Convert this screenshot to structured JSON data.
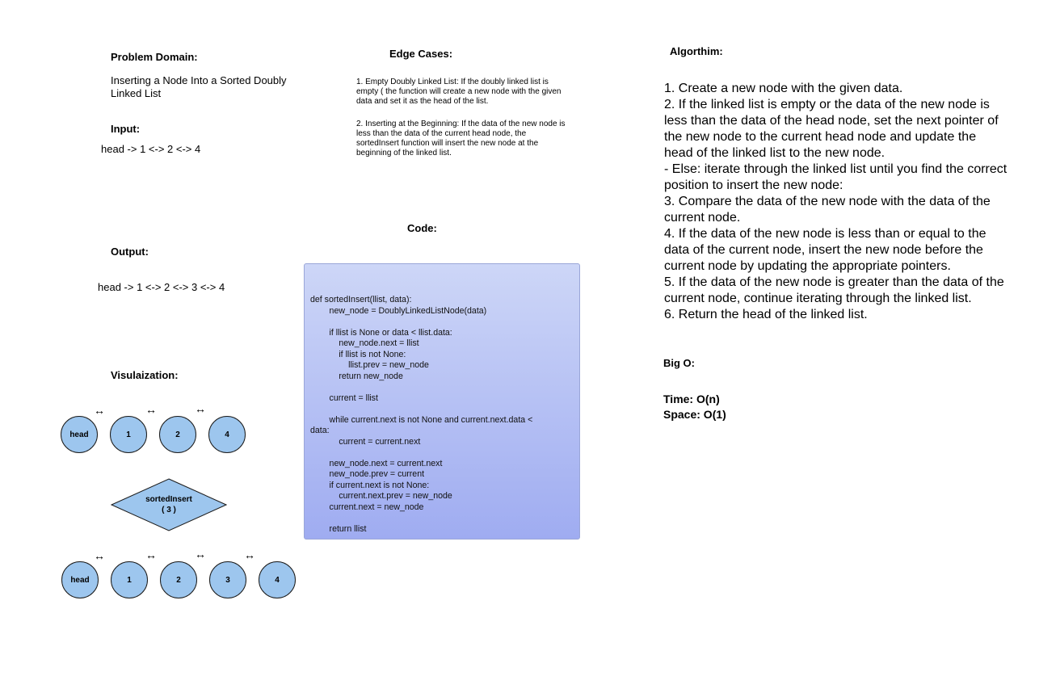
{
  "problem_domain": {
    "heading": "Problem Domain:",
    "text": "Inserting a Node Into a Sorted Doubly\nLinked List"
  },
  "input": {
    "heading": "Input:",
    "text": "head -> 1 <-> 2 <-> 4"
  },
  "output": {
    "heading": "Output:",
    "text": "head -> 1 <-> 2 <-> 3 <-> 4"
  },
  "edge_cases": {
    "heading": "Edge Cases:",
    "case1": "1. Empty Doubly Linked List: If the doubly linked list is\nempty ( the function will create a new node with the given\ndata and set it as the head of the list.",
    "case2": "2. Inserting at the Beginning: If the data of the new node is\nless than the data of the current head node, the\nsortedInsert function will insert the new node at the\nbeginning of the linked list."
  },
  "code": {
    "heading": "Code:",
    "text": "def sortedInsert(llist, data):\n        new_node = DoublyLinkedListNode(data)\n\n        if llist is None or data < llist.data:\n            new_node.next = llist\n            if llist is not None:\n                llist.prev = new_node\n            return new_node\n\n        current = llist\n\n        while current.next is not None and current.next.data <\ndata:\n            current = current.next\n\n        new_node.next = current.next\n        new_node.prev = current\n        if current.next is not None:\n            current.next.prev = new_node\n        current.next = new_node\n\n        return llist"
  },
  "algorithm": {
    "heading": "Algorthim:",
    "text": "1. Create a new node with the given data.\n2. If the linked list is empty or the data of the new node is\nless than the data of the head node, set the next pointer of\nthe new node to the current head node and update the\nhead of the linked list to the new node.\n- Else: iterate through the linked list until you find the correct\nposition to insert the new node:\n3. Compare the data of the new node with the data of the\ncurrent node.\n4. If the data of the new node is less than or equal to the\ndata of the current node, insert the new node before the\ncurrent node by updating the appropriate pointers.\n5. If the data of the new node is greater than the data of the\ncurrent node, continue iterating through the linked list.\n6. Return the head of the linked list."
  },
  "big_o": {
    "heading": "Big O:",
    "time": "Time: O(n)",
    "space": "Space: O(1)"
  },
  "visualization": {
    "heading": "Visulaization:",
    "arrow_glyph": "↔",
    "before_nodes": [
      "head",
      "1",
      "2",
      "4"
    ],
    "operation": "sortedInsert\n( 3 )",
    "after_nodes": [
      "head",
      "1",
      "2",
      "3",
      "4"
    ],
    "node_color": "#9dc6ee"
  }
}
